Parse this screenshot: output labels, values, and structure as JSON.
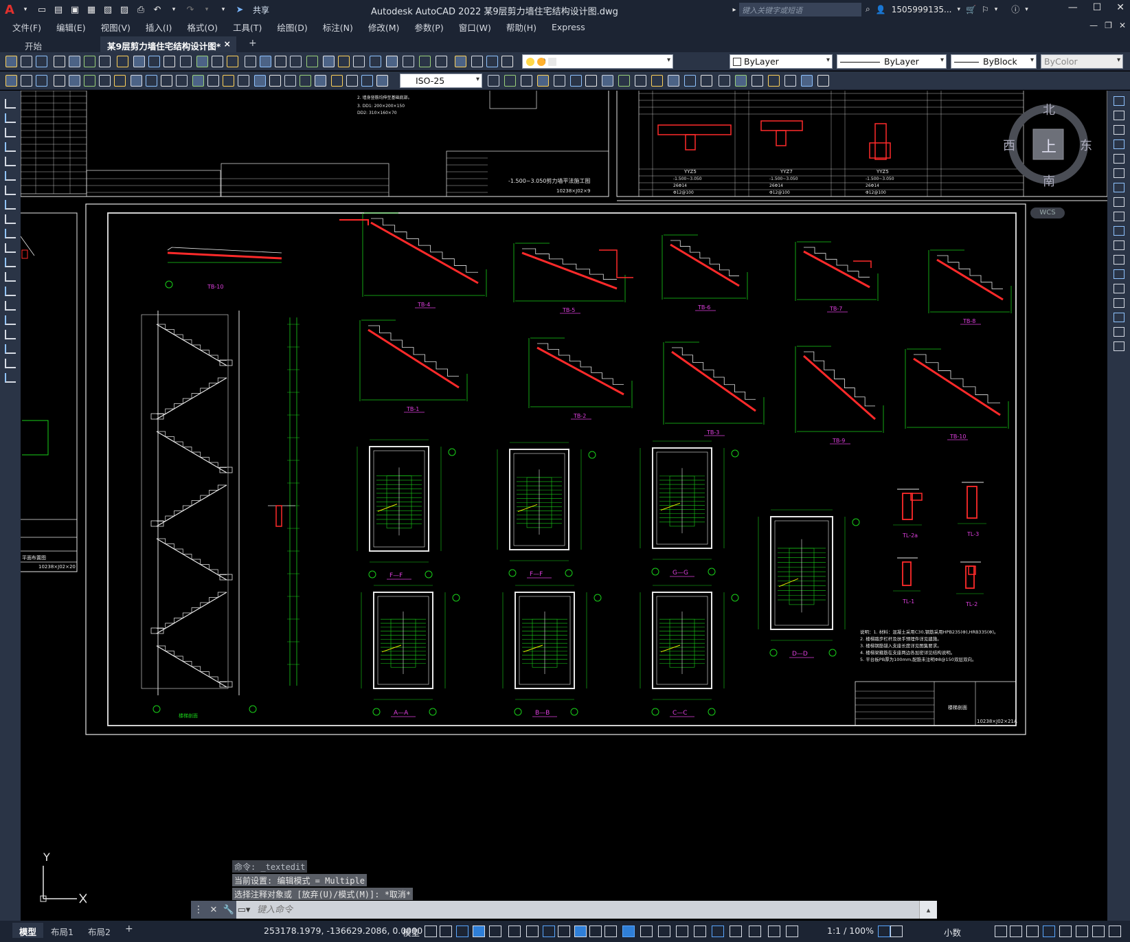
{
  "app": {
    "title": "Autodesk AutoCAD 2022    某9层剪力墙住宅结构设计图.dwg",
    "logo_letter": "A",
    "share_label": "共享",
    "search_placeholder": "键入关键字或短语",
    "user": "1505999135...",
    "window_controls": [
      "minimize-icon",
      "maximize-icon",
      "close-icon"
    ]
  },
  "menu": {
    "items": [
      "文件(F)",
      "编辑(E)",
      "视图(V)",
      "插入(I)",
      "格式(O)",
      "工具(T)",
      "绘图(D)",
      "标注(N)",
      "修改(M)",
      "参数(P)",
      "窗口(W)",
      "帮助(H)",
      "Express"
    ]
  },
  "tabs": {
    "start": "开始",
    "document": "某9层剪力墙住宅结构设计图*",
    "close": "×",
    "add": "+"
  },
  "toolbar": {
    "layer_value": "0",
    "color_value": "ByLayer",
    "linetype_value": "ByLayer",
    "lineweight_value": "ByBlock",
    "plotstyle_value": "ByColor",
    "dimstyle_value": "ISO-25"
  },
  "viewcube": {
    "north": "北",
    "south": "南",
    "east": "东",
    "west": "西",
    "top": "上",
    "wcs": "WCS"
  },
  "ucs": {
    "y": "Y",
    "x": "X"
  },
  "command": {
    "history": [
      "命令: _textedit",
      "当前设置: 编辑模式 = Multiple",
      "选择注释对象或 [放弃(U)/模式(M)]: *取消*"
    ],
    "placeholder": "键入命令"
  },
  "drawing": {
    "sections": [
      "F—F",
      "F—F",
      "G—G",
      "A—A",
      "B—B",
      "C—C",
      "D—D"
    ],
    "stairs_top": [
      "TB-10",
      "TB-4",
      "TB-5",
      "TB-6",
      "TB-7",
      "TB-8"
    ],
    "stairs_mid": [
      "TB-1",
      "TB-2",
      "TB-3",
      "TB-9",
      "TB-10"
    ],
    "beams": [
      "TL-2a",
      "TL-3",
      "TL-1",
      "TL-2"
    ],
    "stair_section_title": "楼梯剖面",
    "sheet_number": "10238×J02×21A",
    "sheet_number_left": "10238×J02×20",
    "plan_title_left": "平面布置图",
    "slab_elev": "-1.500~3.050剪力墙平法施工图",
    "sheet_number_top": "10238×J02×9",
    "notes": [
      "说明：1. 材料：混凝土采用C30,钢筋采用HPB235(Φ),HRB335(Φ)。",
      "2. 楼梯踏步栏杆及扶手预埋件详见建施。",
      "3. 楼梯钢筋锚入支座长度详见图集要求。",
      "4. 楼梯梁箍筋在支座两边各加密详见结构说明。",
      "5. 平台板PB厚为100mm,配筋未注明Φ8@150双层双向。"
    ],
    "top_table_heads": [
      "YYZ5",
      "YYZ7",
      "YYZ5"
    ],
    "top_table_rows": [
      "-1.500~3.050",
      "26Φ14",
      "Φ12@100"
    ]
  },
  "status": {
    "layout_tabs": [
      "模型",
      "布局1",
      "布局2"
    ],
    "add": "+",
    "coords": "253178.1979, -136629.2086, 0.0000",
    "mode": "模型",
    "scale": "1:1 / 100%",
    "units": "小数"
  }
}
